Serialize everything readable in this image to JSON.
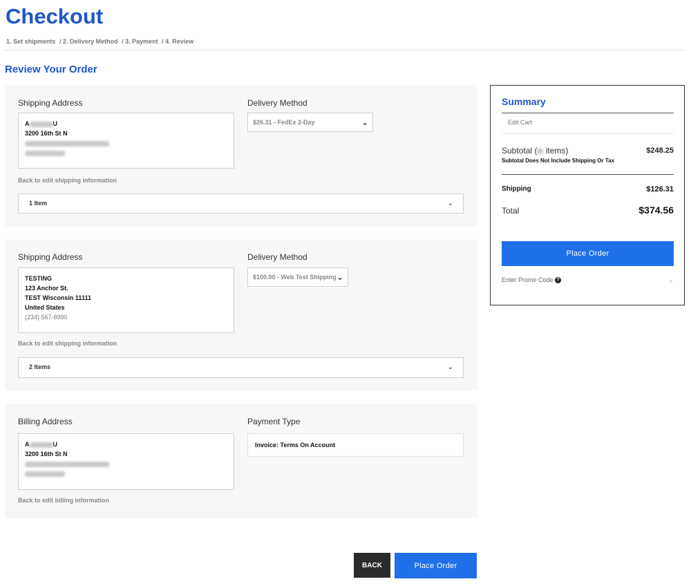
{
  "header": {
    "title": "Checkout",
    "steps": [
      "1. Set shipments",
      "/ 2. Delivery Method",
      "/ 3. Payment",
      "/ 4. Review"
    ]
  },
  "review_title": "Review Your Order",
  "shipments": [
    {
      "address_label": "Shipping Address",
      "address_lines": [
        "A",
        "U",
        "3200 16th St N"
      ],
      "delivery_label": "Delivery Method",
      "delivery_value": "$26.31 - FedEx 2-Day",
      "edit_link": "Back to edit shipping information",
      "items": "1 Item"
    },
    {
      "address_label": "Shipping Address",
      "address_lines": [
        "TESTING",
        "123 Anchor St.",
        "TEST Wisconsin 11111",
        "United States",
        "(234) 567-8990"
      ],
      "delivery_label": "Delivery Method",
      "delivery_value": "$100.00 - Web Test Shipping",
      "edit_link": "Back to edit shipping information",
      "items": "2 Items"
    }
  ],
  "billing": {
    "address_label": "Billing Address",
    "address_lines": [
      "A",
      "U",
      "3200 16th St N"
    ],
    "edit_link": "Back to edit billing information",
    "payment_label": "Payment Type",
    "payment_value": "Invoice: Terms On Account"
  },
  "summary": {
    "title": "Summary",
    "edit_cart": "Edit Cart",
    "subtotal_label_pre": "Subtotal (",
    "subtotal_label_post": " items)",
    "subtotal_note": "Subtotal Does Not Include Shipping Or Tax",
    "subtotal_value": "$248.25",
    "shipping_label": "Shipping",
    "shipping_value": "$126.31",
    "total_label": "Total",
    "total_value": "$374.56",
    "place_order": "Place Order",
    "promo_label": "Enter Promo Code"
  },
  "footer": {
    "back": "BACK",
    "place_order": "Place Order"
  },
  "colors": {
    "accent": "#1f57c7",
    "button": "#1f6fe8"
  }
}
